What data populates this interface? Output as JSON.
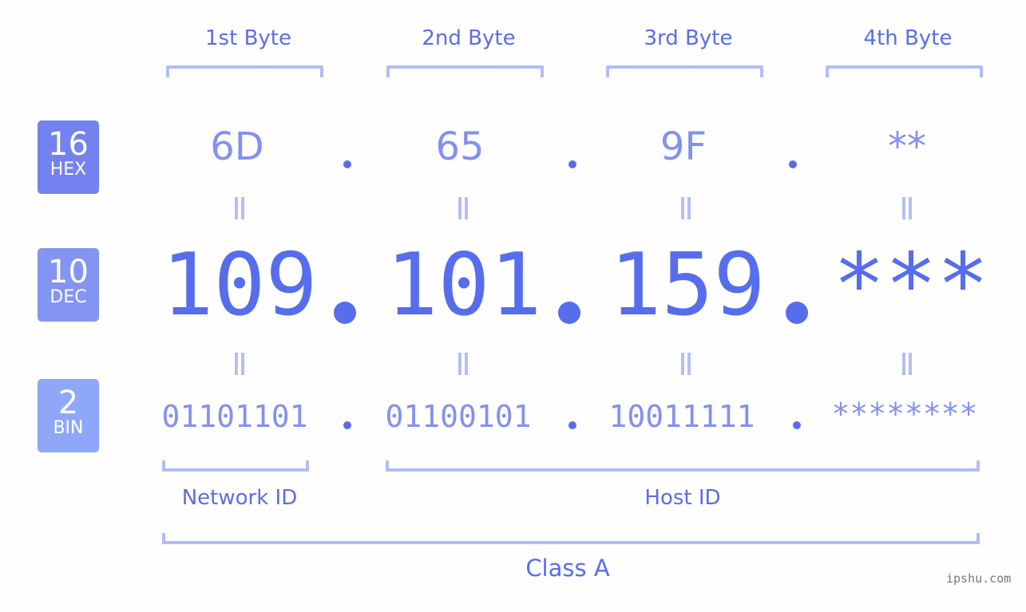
{
  "bases": [
    {
      "number": "16",
      "label": "HEX",
      "color": "#7382ee"
    },
    {
      "number": "10",
      "label": "DEC",
      "color": "#8494f3"
    },
    {
      "number": "2",
      "label": "BIN",
      "color": "#8ea7f8"
    }
  ],
  "bytes": [
    {
      "label": "1st Byte",
      "hex": "6D",
      "dec": "109",
      "bin": "01101101"
    },
    {
      "label": "2nd Byte",
      "hex": "65",
      "dec": "101",
      "bin": "01100101"
    },
    {
      "label": "3rd Byte",
      "hex": "9F",
      "dec": "159",
      "bin": "10011111"
    },
    {
      "label": "4th Byte",
      "hex": "**",
      "dec": "***",
      "bin": "********"
    }
  ],
  "network_id_label": "Network ID",
  "host_id_label": "Host ID",
  "class_label": "Class A",
  "watermark": "ipshu.com"
}
